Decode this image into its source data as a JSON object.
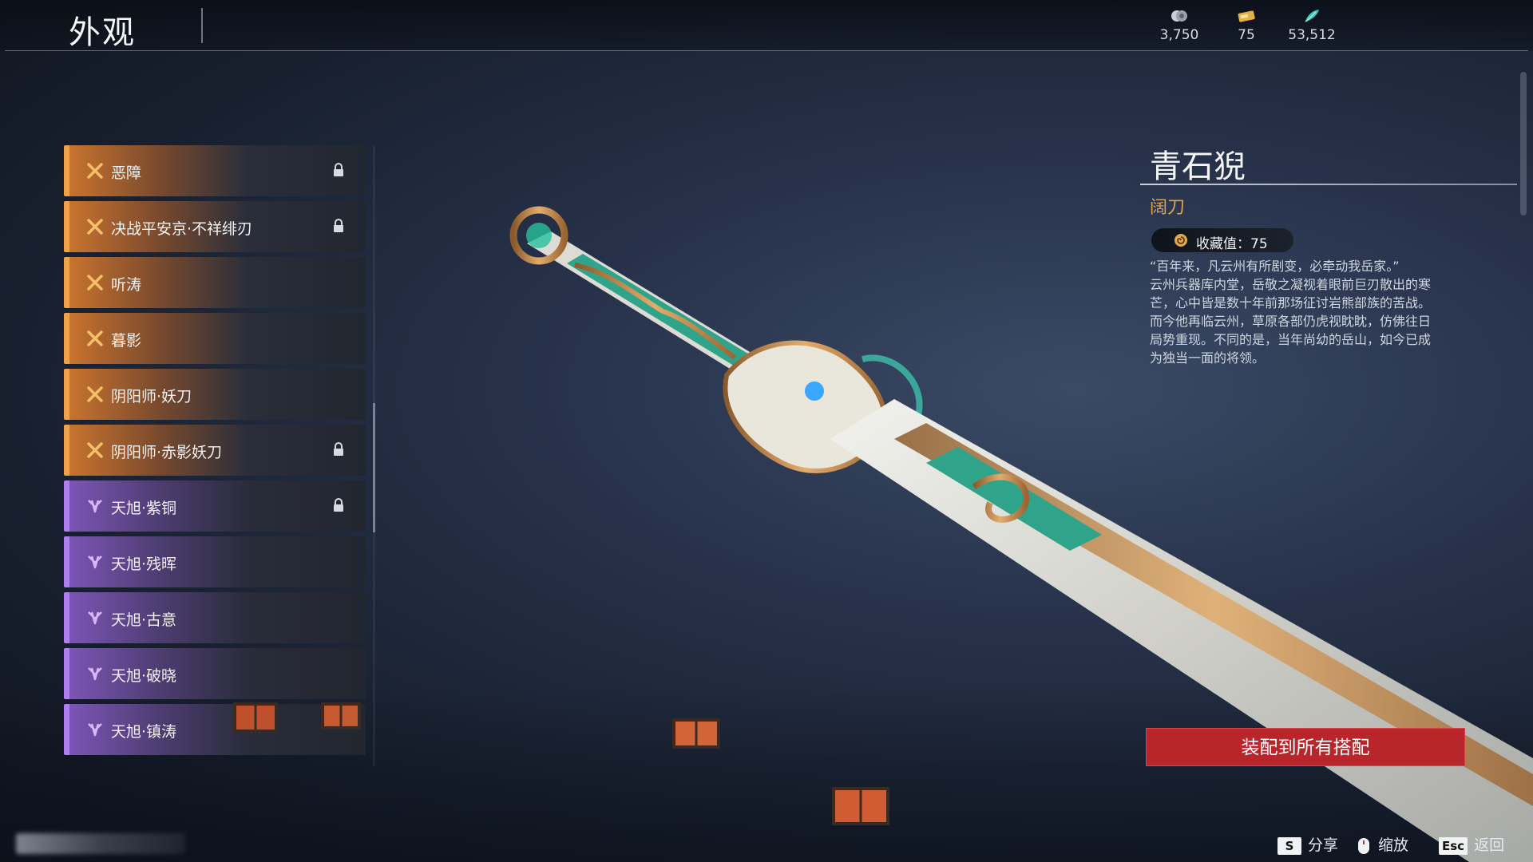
{
  "header": {
    "title": "外观"
  },
  "currencies": [
    {
      "icon": "silver-coin-icon",
      "value": "3,750"
    },
    {
      "icon": "gold-ticket-icon",
      "value": "75"
    },
    {
      "icon": "jade-feather-icon",
      "value": "53,512"
    }
  ],
  "skin_list": [
    {
      "label": "恶障",
      "rarity": "orange",
      "locked": true
    },
    {
      "label": "决战平安京·不祥绯刃",
      "rarity": "orange",
      "locked": true
    },
    {
      "label": "听涛",
      "rarity": "orange",
      "locked": false
    },
    {
      "label": "暮影",
      "rarity": "orange",
      "locked": false
    },
    {
      "label": "阴阳师·妖刀",
      "rarity": "orange",
      "locked": false
    },
    {
      "label": "阴阳师·赤影妖刀",
      "rarity": "orange",
      "locked": true
    },
    {
      "label": "天旭·紫铜",
      "rarity": "purple",
      "locked": true
    },
    {
      "label": "天旭·残晖",
      "rarity": "purple",
      "locked": false
    },
    {
      "label": "天旭·古意",
      "rarity": "purple",
      "locked": false
    },
    {
      "label": "天旭·破晓",
      "rarity": "purple",
      "locked": false
    },
    {
      "label": "天旭·镇涛",
      "rarity": "purple",
      "locked": false
    }
  ],
  "detail": {
    "name": "青石猊",
    "type": "阔刀",
    "collection": "收藏值：75",
    "description_lines": [
      "“百年来，凡云州有所剧变，必牵动我岳家。”",
      "云州兵器库内堂，岳敬之凝视着眼前巨刃散出的寒",
      "芒，心中皆是数十年前那场征讨岩熊部族的苦战。",
      "而今他再临云州，草原各部仍虎视眈眈，仿佛往日",
      "局势重现。不同的是，当年尚幼的岳山，如今已成",
      "为独当一面的将领。"
    ]
  },
  "equip_button": "装配到所有搭配",
  "footer": {
    "share_key": "S",
    "share_label": "分享",
    "zoom_label": "缩放",
    "back_key": "Esc",
    "back_label": "返回"
  },
  "colors": {
    "orange_rarity": "#f0a24a",
    "purple_rarity": "#b07ef0",
    "accent_red": "#b8252a",
    "type_gold": "#e0a24c"
  }
}
